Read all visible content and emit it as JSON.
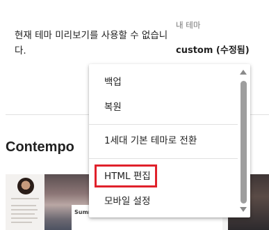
{
  "current_theme": {
    "preview_message": "현재 테마 미리보기를 사용할 수 없습니다.",
    "my_theme_label": "내 테마",
    "theme_name": "custom (수정됨)"
  },
  "gallery": {
    "title": "Contempo",
    "thumbnail_caption": "Summer"
  },
  "menu": {
    "items": [
      {
        "label": "백업"
      },
      {
        "label": "복원"
      },
      {
        "label": "1세대 기본 테마로 전환"
      },
      {
        "label": "HTML 편집"
      },
      {
        "label": "모바일 설정"
      }
    ],
    "highlighted_item": "HTML 편집",
    "highlight_color": "#e0212b"
  },
  "icons": {
    "scroll_up": "triangle-up-icon",
    "scroll_down": "triangle-down-icon"
  }
}
